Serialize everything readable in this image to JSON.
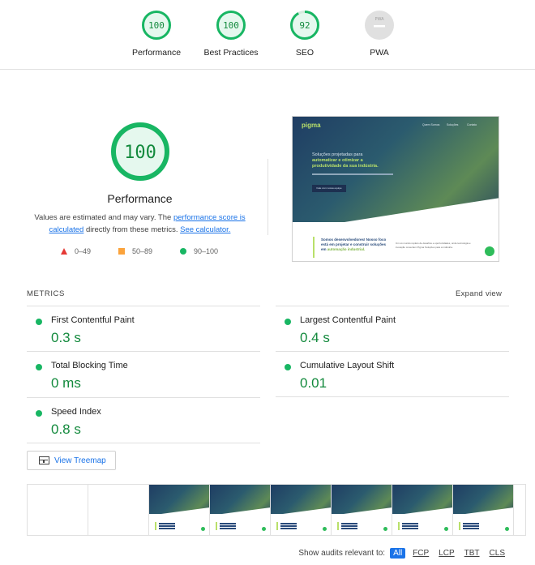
{
  "summary": {
    "gauges": [
      {
        "score": "100",
        "label": "Performance",
        "color": "#18b663"
      },
      {
        "score": "100",
        "label": "Best Practices",
        "color": "#18b663"
      },
      {
        "score": "92",
        "label": "SEO",
        "color": "#18b663"
      },
      {
        "score": "PWA",
        "label": "PWA",
        "color": "#9e9e9e"
      }
    ]
  },
  "performance": {
    "score": "100",
    "title": "Performance",
    "desc_prefix": "Values are estimated and may vary. The",
    "link_score": "performance score is calculated",
    "desc_mid": "directly from these metrics.",
    "link_calc": "See calculator.",
    "legend": {
      "fail": "0–49",
      "average": "50–89",
      "pass": "90–100"
    }
  },
  "screenshot": {
    "logo": "pigma",
    "nav": [
      "Quem Somos",
      "Soluções",
      "Contato"
    ],
    "headline": "Soluções projetadas para",
    "headline_accent": "automatizar e otimizar a",
    "headline_end": "produtividade da sua indústria.",
    "cta": "Fale com nossa equipe",
    "section_title": "Somos desenvolvedores! Nosso foco está em projetar e construir soluções em",
    "section_accent": "automação industrial.",
    "section_text": "Um só mundo repleto de desafios e oportunidades, onde tecnologia e inovação conectam Pigma Soluções para a indústria."
  },
  "metrics": {
    "heading": "METRICS",
    "expand": "Expand view",
    "items": [
      {
        "name": "First Contentful Paint",
        "value": "0.3 s"
      },
      {
        "name": "Largest Contentful Paint",
        "value": "0.4 s"
      },
      {
        "name": "Total Blocking Time",
        "value": "0 ms"
      },
      {
        "name": "Cumulative Layout Shift",
        "value": "0.01"
      },
      {
        "name": "Speed Index",
        "value": "0.8 s"
      }
    ]
  },
  "treemap": {
    "label": "View Treemap"
  },
  "filter": {
    "label": "Show audits relevant to:",
    "chips": [
      "All",
      "FCP",
      "LCP",
      "TBT",
      "CLS"
    ]
  },
  "colors": {
    "pass": "#18b663",
    "link": "#1a73e8",
    "value": "#138a3d"
  }
}
